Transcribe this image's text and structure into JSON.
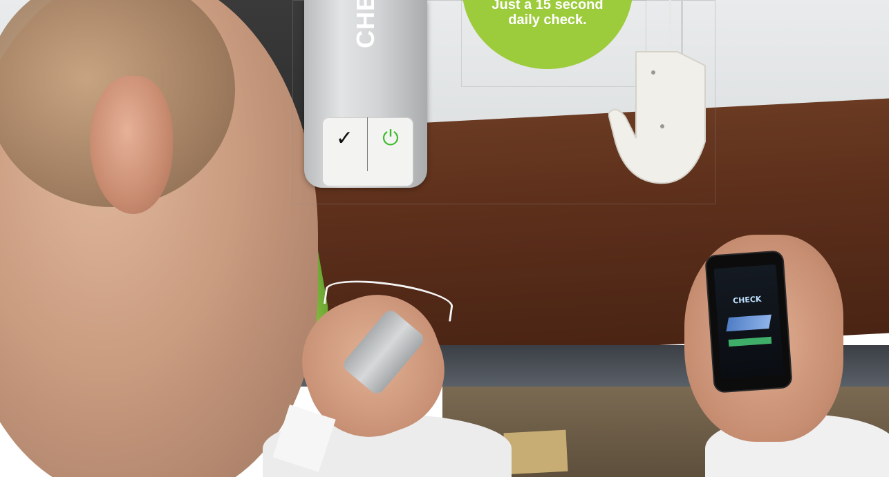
{
  "scene": {
    "description_visible": false
  },
  "sensor": {
    "brand_partial": "CHE",
    "check_button_glyph": "✓",
    "power_button_glyph": "⏻",
    "colors": {
      "power_accent": "#3dbb2c",
      "body": "#d2d4d5"
    }
  },
  "callout": {
    "line1": "Just a 15 second",
    "line2": "daily check.",
    "color": "#9ccb3b"
  },
  "phone_app": {
    "title": "CHECK"
  }
}
